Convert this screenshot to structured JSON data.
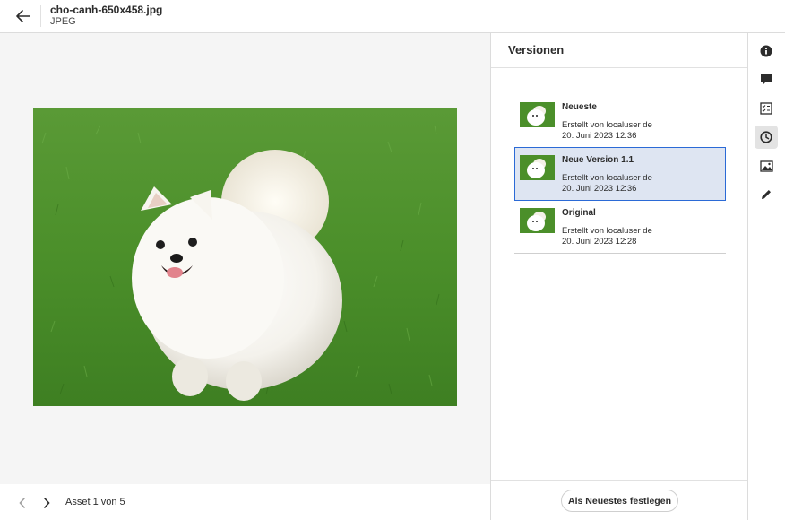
{
  "header": {
    "back_icon": "arrow-left-icon",
    "file_name": "cho-canh-650x458.jpg",
    "file_type": "JPEG"
  },
  "preview": {
    "image_alt": "white pomeranian dog on grass"
  },
  "bottom_nav": {
    "prev_icon": "chevron-left-icon",
    "next_icon": "chevron-right-icon",
    "counter": "Asset 1 von 5"
  },
  "versions_panel": {
    "title": "Versionen",
    "items": [
      {
        "title": "Neueste",
        "created_by": "Erstellt von localuser de",
        "date": "20. Juni 2023 12:36",
        "selected": false
      },
      {
        "title": "Neue Version 1.1",
        "created_by": "Erstellt von localuser de",
        "date": "20. Juni 2023 12:36",
        "selected": true
      },
      {
        "title": "Original",
        "created_by": "Erstellt von localuser de",
        "date": "20. Juni 2023 12:28",
        "selected": false
      }
    ],
    "set_latest_label": "Als Neuestes festlegen"
  },
  "rail": {
    "items": [
      {
        "icon": "info-icon",
        "active": false
      },
      {
        "icon": "comment-icon",
        "active": false
      },
      {
        "icon": "tasks-icon",
        "active": false
      },
      {
        "icon": "clock-history-icon",
        "active": true
      },
      {
        "icon": "image-renditions-icon",
        "active": false
      },
      {
        "icon": "pencil-edit-icon",
        "active": false
      }
    ]
  },
  "colors": {
    "accent": "#2b6ad6",
    "selected_bg": "#dee5f2",
    "preview_bg": "#f5f5f5",
    "grass": "#4a8f2c"
  }
}
